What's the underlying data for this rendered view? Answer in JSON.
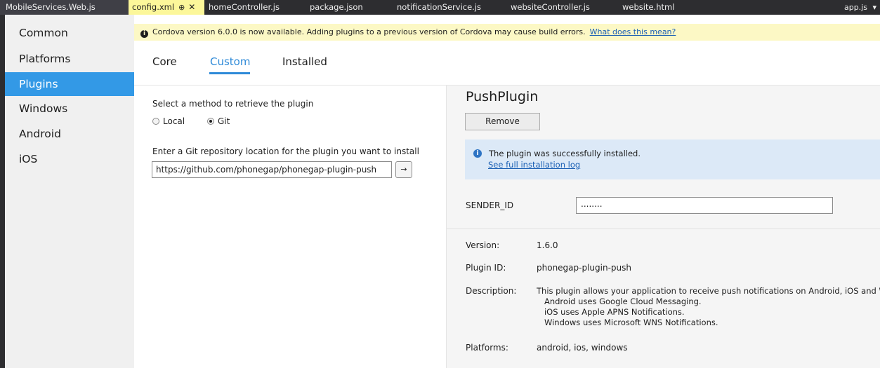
{
  "tabs": [
    {
      "label": "MobileServices.Web.js"
    },
    {
      "label": "config.xml",
      "pin": "⊕",
      "close": "✕"
    },
    {
      "label": "homeController.js"
    },
    {
      "label": "package.json"
    },
    {
      "label": "notificationService.js"
    },
    {
      "label": "websiteController.js"
    },
    {
      "label": "website.html"
    }
  ],
  "tab_overflow": {
    "label": "app.js",
    "icon": "▾"
  },
  "sidebar": {
    "items": [
      {
        "label": "Common"
      },
      {
        "label": "Platforms"
      },
      {
        "label": "Plugins"
      },
      {
        "label": "Windows"
      },
      {
        "label": "Android"
      },
      {
        "label": "iOS"
      }
    ],
    "active_index": 2
  },
  "infobar": {
    "message": "Cordova version 6.0.0 is now available. Adding plugins to a previous version of Cordova may cause build errors.",
    "link": "What does this mean?"
  },
  "content_tabs": [
    {
      "label": "Core"
    },
    {
      "label": "Custom"
    },
    {
      "label": "Installed"
    }
  ],
  "custom": {
    "method_label": "Select a method to retrieve the plugin",
    "radio_local": "Local",
    "radio_git": "Git",
    "git_label": "Enter a Git repository location for the plugin you want to install",
    "git_value": "https://github.com/phonegap/phonegap-plugin-push",
    "go_icon": "→"
  },
  "plugin": {
    "title": "PushPlugin",
    "remove_label": "Remove",
    "success_message": "The plugin was successfully installed.",
    "success_link": "See full installation log",
    "sender_label": "SENDER_ID",
    "sender_value": "........",
    "version_label": "Version:",
    "version_value": "1.6.0",
    "id_label": "Plugin ID:",
    "id_value": "phonegap-plugin-push",
    "description_label": "Description:",
    "description_lines": [
      "This plugin allows your application to receive push notifications on Android, iOS and Wir",
      "   Android uses Google Cloud Messaging.",
      "   iOS uses Apple APNS Notifications.",
      "   Windows uses Microsoft WNS Notifications."
    ],
    "platforms_label": "Platforms:",
    "platforms_value": "android, ios, windows"
  },
  "colors": {
    "accent": "#3399e6",
    "active_tab": "#fcf79a",
    "infobar": "#fcf8c5",
    "success_box": "#dce9f7"
  }
}
